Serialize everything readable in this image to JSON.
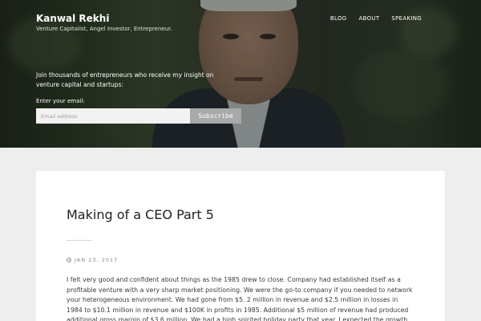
{
  "site": {
    "title": "Kanwal Rekhi",
    "description": "Venture Capitalist, Angel Investor, Entrepreneur."
  },
  "nav": {
    "items": [
      {
        "label": "BLOG"
      },
      {
        "label": "ABOUT"
      },
      {
        "label": "SPEAKING"
      }
    ]
  },
  "hero": {
    "promo_text": "Join thousands of entrepreneurs who receive my insight on venture capital and startups:",
    "email_label": "Enter your email:",
    "email_placeholder": "Email address",
    "email_value": "",
    "subscribe_label": "Subscribe"
  },
  "post": {
    "title": "Making of a CEO Part 5",
    "date": "JAN 23, 2017",
    "body": "I felt very good and confident about things as the 1985 drew to close. Company had established itself as a profitable venture with a very sharp market positioning. We were the go-to company if you needed to network your heterogeneous environment. We had gone from $5. 2 million in revenue and $2.5 million in losses in 1984 to $10.1 million in revenue and  $100K in profits in 1985. Additional $5 million of revenue had produced additional gross margin of $3.6 million. We had a high spirited holiday party that year. I expected the growth to"
  },
  "icons": {
    "date": "clock-icon"
  }
}
